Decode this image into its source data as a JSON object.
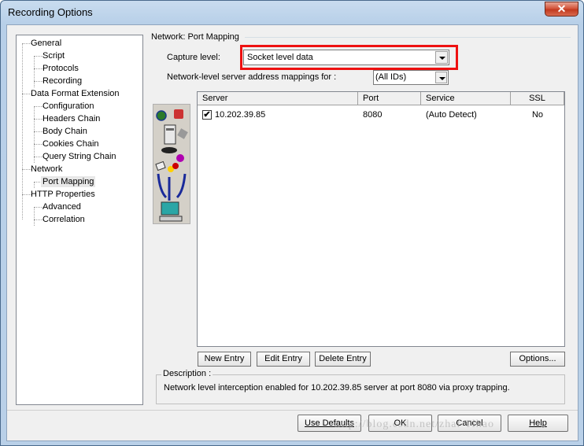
{
  "window": {
    "title": "Recording Options",
    "close_glyph": "✕"
  },
  "tree": {
    "items": [
      {
        "label": "General",
        "level": 0
      },
      {
        "label": "Script",
        "level": 1
      },
      {
        "label": "Protocols",
        "level": 1
      },
      {
        "label": "Recording",
        "level": 1
      },
      {
        "label": "Data Format Extension",
        "level": 0
      },
      {
        "label": "Configuration",
        "level": 1
      },
      {
        "label": "Headers Chain",
        "level": 1
      },
      {
        "label": "Body Chain",
        "level": 1
      },
      {
        "label": "Cookies Chain",
        "level": 1
      },
      {
        "label": "Query String Chain",
        "level": 1
      },
      {
        "label": "Network",
        "level": 0
      },
      {
        "label": "Port Mapping",
        "level": 1,
        "selected": true
      },
      {
        "label": "HTTP Properties",
        "level": 0
      },
      {
        "label": "Advanced",
        "level": 1
      },
      {
        "label": "Correlation",
        "level": 1
      }
    ]
  },
  "panel": {
    "group_title": "Network: Port Mapping",
    "capture_level_label": "Capture level:",
    "capture_level_value": "Socket level data",
    "mappings_label": "Network-level server address mappings for :",
    "mappings_value": "(All IDs)"
  },
  "table": {
    "columns": [
      "Server",
      "Port",
      "Service",
      "SSL"
    ],
    "rows": [
      {
        "checked": true,
        "check_glyph": "✔",
        "server": "10.202.39.85",
        "port": "8080",
        "service": "(Auto Detect)",
        "ssl": "No"
      }
    ]
  },
  "buttons": {
    "new_entry": "New Entry",
    "edit_entry": "Edit Entry",
    "delete_entry": "Delete Entry",
    "options": "Options...",
    "use_defaults": "Use Defaults",
    "ok": "OK",
    "cancel": "Cancel",
    "help": "Help"
  },
  "description": {
    "label": "Description :",
    "text": "Network level interception enabled for 10.202.39.85 server at port 8080 via proxy trapping."
  },
  "watermark": "http://blog.csdn.net/zhaf Tlhao",
  "colors": {
    "highlight": "#ee1111",
    "title_bg": "#b9d0e8",
    "close_red": "#c23a1f"
  }
}
